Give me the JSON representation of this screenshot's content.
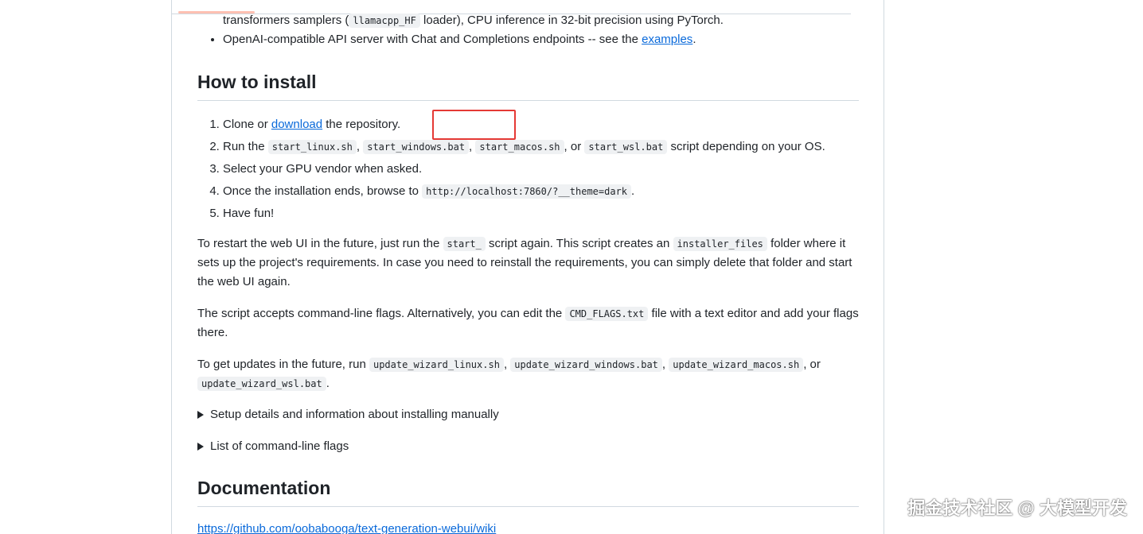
{
  "features": {
    "cont_text_before": "transformers samplers (",
    "cont_code": "llamacpp_HF",
    "cont_text_after": " loader), CPU inference in 32-bit precision using PyTorch.",
    "api_text": "OpenAI-compatible API server with Chat and Completions endpoints -- see the ",
    "api_link": "examples",
    "api_end": "."
  },
  "install": {
    "heading": "How to install",
    "step1_before": "Clone or ",
    "step1_link": "download",
    "step1_after": " the repository.",
    "step2_before": "Run the ",
    "step2_code1": "start_linux.sh",
    "step2_sep1": ", ",
    "step2_code2": "start_windows.bat",
    "step2_sep2": ", ",
    "step2_code3": "start_macos.sh",
    "step2_sep3": ", or ",
    "step2_code4": "start_wsl.bat",
    "step2_after": " script depending on your OS.",
    "step3": "Select your GPU vendor when asked.",
    "step4_before": "Once the installation ends, browse to ",
    "step4_code": "http://localhost:7860/?__theme=dark",
    "step4_after": ".",
    "step5": "Have fun!"
  },
  "restart": {
    "t1": "To restart the web UI in the future, just run the ",
    "c1": "start_",
    "t2": " script again. This script creates an ",
    "c2": "installer_files",
    "t3": " folder where it sets up the project's requirements. In case you need to reinstall the requirements, you can simply delete that folder and start the web UI again."
  },
  "flags": {
    "t1": "The script accepts command-line flags. Alternatively, you can edit the ",
    "c1": "CMD_FLAGS.txt",
    "t2": " file with a text editor and add your flags there."
  },
  "updates": {
    "t1": "To get updates in the future, run ",
    "c1": "update_wizard_linux.sh",
    "s1": ", ",
    "c2": "update_wizard_windows.bat",
    "s2": ", ",
    "c3": "update_wizard_macos.sh",
    "s3": ", or ",
    "c4": "update_wizard_wsl.bat",
    "t2": "."
  },
  "details": {
    "setup": "Setup details and information about installing manually",
    "cmdflags": "List of command-line flags"
  },
  "docs": {
    "heading": "Documentation",
    "link": "https://github.com/oobabooga/text-generation-webui/wiki"
  },
  "watermark": "掘金技术社区 @ 大模型开发"
}
